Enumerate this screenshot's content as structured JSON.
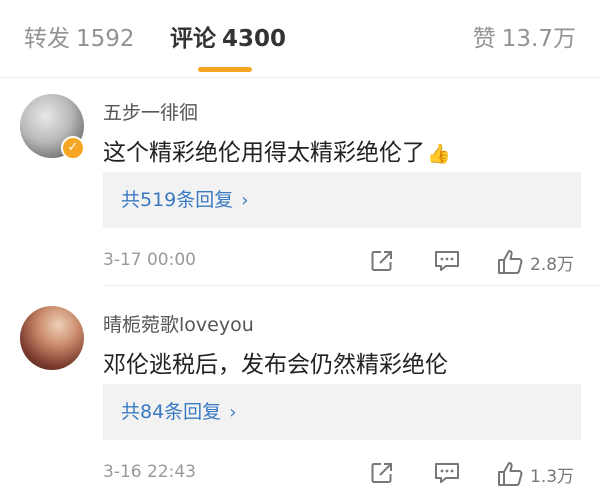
{
  "tabs": {
    "repost": {
      "label": "转发",
      "count": "1592"
    },
    "comments": {
      "label": "评论",
      "count": "4300"
    },
    "likes": {
      "label": "赞",
      "count": "13.7万"
    }
  },
  "colors": {
    "accent": "#f5a623",
    "link": "#3b7ac3"
  },
  "comments": [
    {
      "username": "五步一徘徊",
      "text": "这个精彩绝伦用得太精彩绝伦了",
      "emoji": "👍",
      "verified_icon": "verified-check-icon",
      "replies_label": "共519条回复",
      "time": "3-17 00:00",
      "like_count": "2.8万"
    },
    {
      "username": "晴栀菀歌loveyou",
      "text": "邓伦逃税后，发布会仍然精彩绝伦",
      "replies_label": "共84条回复",
      "time": "3-16 22:43",
      "like_count": "1.3万"
    }
  ],
  "icons": {
    "chevron": "›",
    "share": "share-icon",
    "reply": "comment-icon",
    "like": "thumbs-up-icon"
  }
}
